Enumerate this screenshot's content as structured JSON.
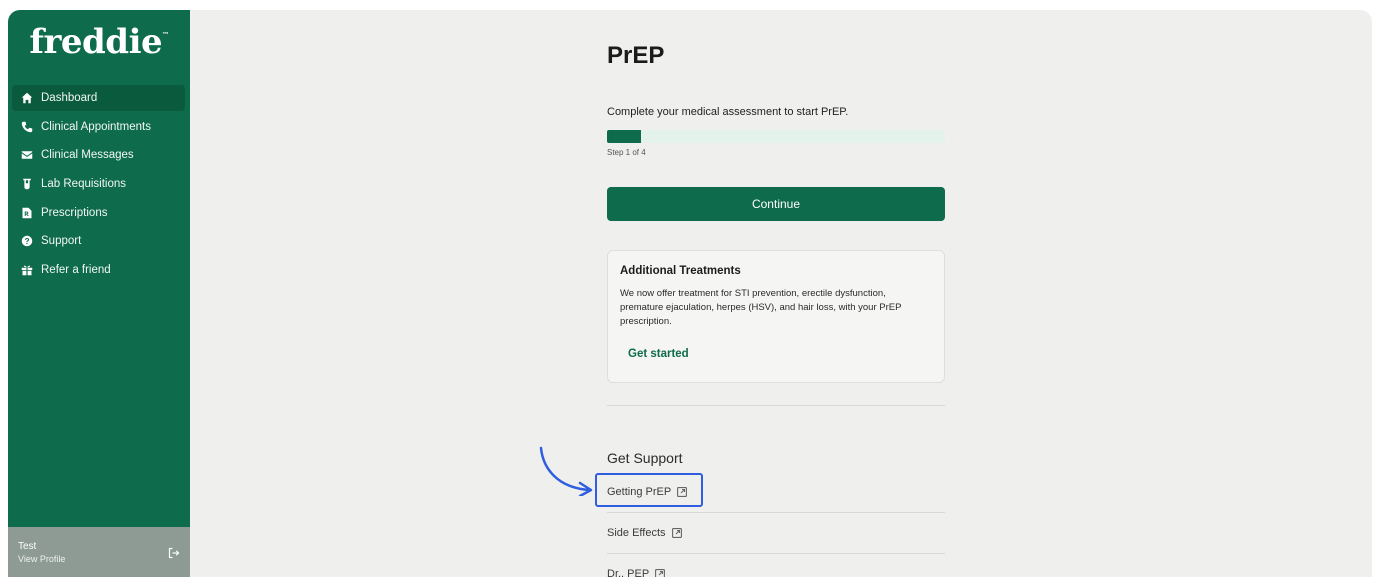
{
  "brand": {
    "name": "freddie",
    "mark": "™"
  },
  "sidebar": {
    "items": [
      {
        "label": "Dashboard",
        "icon": "home-icon",
        "active": true
      },
      {
        "label": "Clinical Appointments",
        "icon": "phone-icon",
        "active": false
      },
      {
        "label": "Clinical Messages",
        "icon": "envelope-icon",
        "active": false
      },
      {
        "label": "Lab Requisitions",
        "icon": "test-tube-icon",
        "active": false
      },
      {
        "label": "Prescriptions",
        "icon": "prescription-icon",
        "active": false
      },
      {
        "label": "Support",
        "icon": "help-icon",
        "active": false
      },
      {
        "label": "Refer a friend",
        "icon": "gift-icon",
        "active": false
      }
    ],
    "profile": {
      "name": "Test",
      "link": "View Profile",
      "icon": "logout-icon"
    }
  },
  "main": {
    "title": "PrEP",
    "intro": "Complete your medical assessment to start PrEP.",
    "progress": {
      "fraction": 0.1,
      "step_text": "Step 1 of 4"
    },
    "continue_label": "Continue",
    "card": {
      "title": "Additional Treatments",
      "body": "We now offer treatment for STI prevention, erectile dysfunction, premature ejaculation, herpes (HSV), and hair loss, with your PrEP prescription.",
      "link": "Get started"
    },
    "support": {
      "title": "Get Support",
      "links": [
        {
          "label": "Getting PrEP",
          "icon": "external-link-icon"
        },
        {
          "label": "Side Effects",
          "icon": "external-link-icon"
        },
        {
          "label": "Dr.. PEP",
          "icon": "external-link-icon"
        }
      ]
    }
  },
  "colors": {
    "brand_green": "#0e6b4b",
    "highlight_blue": "#2f5fe0",
    "progress_track": "#e4f2ec"
  }
}
